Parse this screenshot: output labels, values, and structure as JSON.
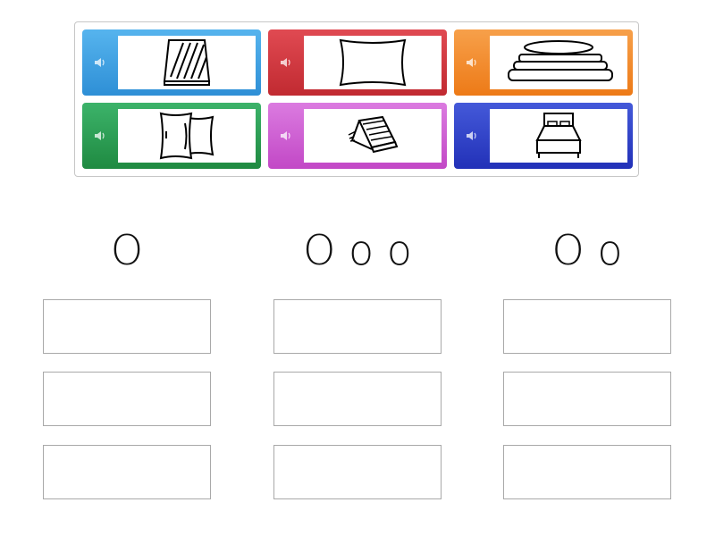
{
  "cards": [
    {
      "color": "#3d9fe0",
      "name": "mattress"
    },
    {
      "color": "#d0363d",
      "name": "pillow"
    },
    {
      "color": "#f18b2c",
      "name": "folded-sheets"
    },
    {
      "color": "#2a9a4e",
      "name": "pillows-pair"
    },
    {
      "color": "#d25ed6",
      "name": "rug"
    },
    {
      "color": "#2f3fc9",
      "name": "bed"
    }
  ],
  "speaker_icon": "speaker-icon",
  "columns": [
    {
      "heading": "O"
    },
    {
      "heading": "O o o"
    },
    {
      "heading": "O o"
    }
  ]
}
